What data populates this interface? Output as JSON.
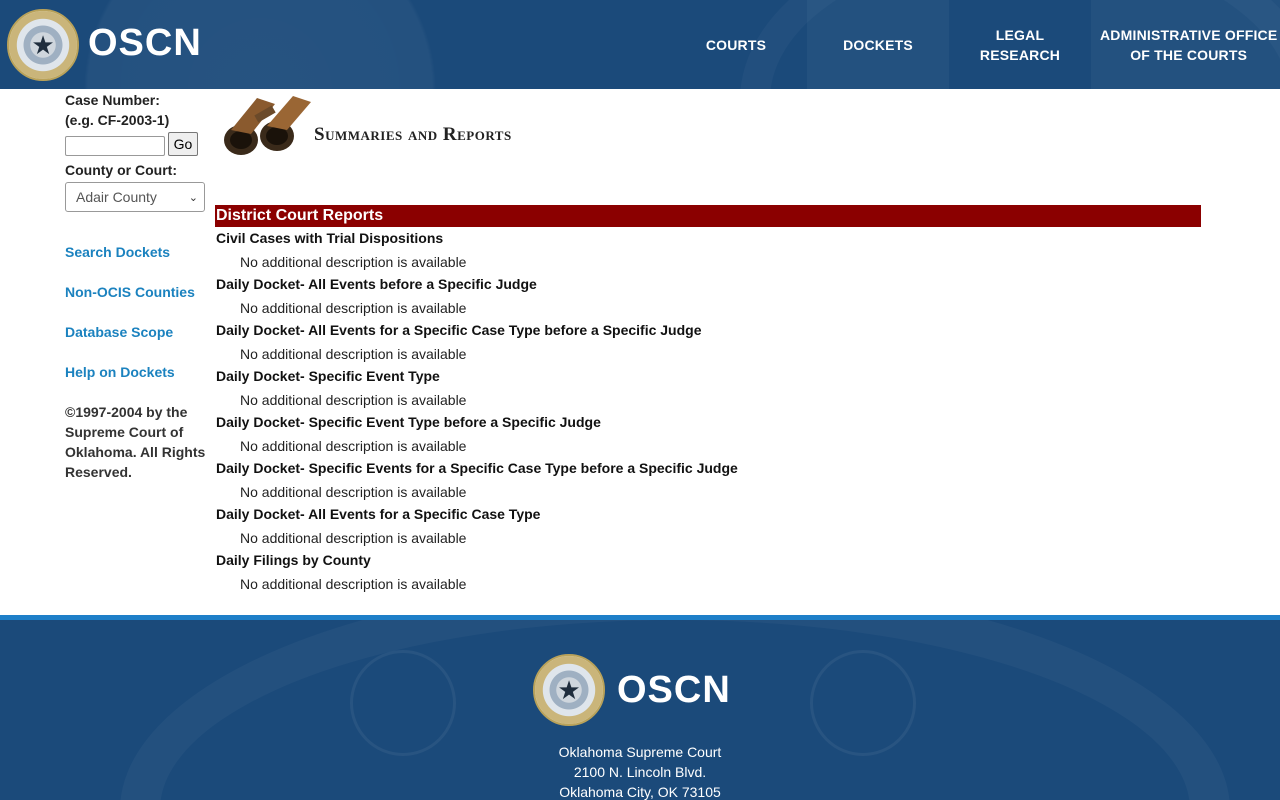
{
  "header": {
    "logo_text": "OSCN",
    "nav": {
      "courts": "COURTS",
      "dockets": "DOCKETS",
      "legal_line1": "LEGAL",
      "legal_line2": "RESEARCH",
      "admin_line1": "ADMINISTRATIVE OFFICE",
      "admin_line2": "OF THE COURTS"
    }
  },
  "sidebar": {
    "case_number_label": "Case Number:",
    "case_number_example": "(e.g. CF-2003-1)",
    "case_number_value": "",
    "go_label": "Go",
    "county_label": "County or Court:",
    "county_selected": "Adair County",
    "links": [
      "Search Dockets",
      "Non-OCIS Counties",
      "Database Scope",
      "Help on Dockets"
    ],
    "copyright": "©1997-2004 by the Supreme Court of Oklahoma. All Rights Reserved."
  },
  "main": {
    "title": "Summaries and Reports",
    "section_title": "District Court Reports",
    "reports": [
      {
        "title": "Civil Cases with Trial Dispositions",
        "desc": "No additional description is available"
      },
      {
        "title": "Daily Docket- All Events before a Specific Judge",
        "desc": "No additional description is available"
      },
      {
        "title": "Daily Docket- All Events for a Specific Case Type before a Specific Judge",
        "desc": "No additional description is available"
      },
      {
        "title": "Daily Docket- Specific Event Type",
        "desc": "No additional description is available"
      },
      {
        "title": "Daily Docket- Specific Event Type before a Specific Judge",
        "desc": "No additional description is available"
      },
      {
        "title": "Daily Docket- Specific Events for a Specific Case Type before a Specific Judge",
        "desc": "No additional description is available"
      },
      {
        "title": "Daily Docket- All Events for a Specific Case Type",
        "desc": "No additional description is available"
      },
      {
        "title": "Daily Filings by County",
        "desc": "No additional description is available"
      }
    ]
  },
  "footer": {
    "logo_text": "OSCN",
    "address": [
      "Oklahoma Supreme Court",
      "2100 N. Lincoln Blvd.",
      "Oklahoma City, OK 73105"
    ]
  },
  "colors": {
    "header_bg": "#1b4a7a",
    "section_bar": "#8b0000",
    "link": "#1b82bf",
    "footer_border": "#1e7fc8"
  }
}
